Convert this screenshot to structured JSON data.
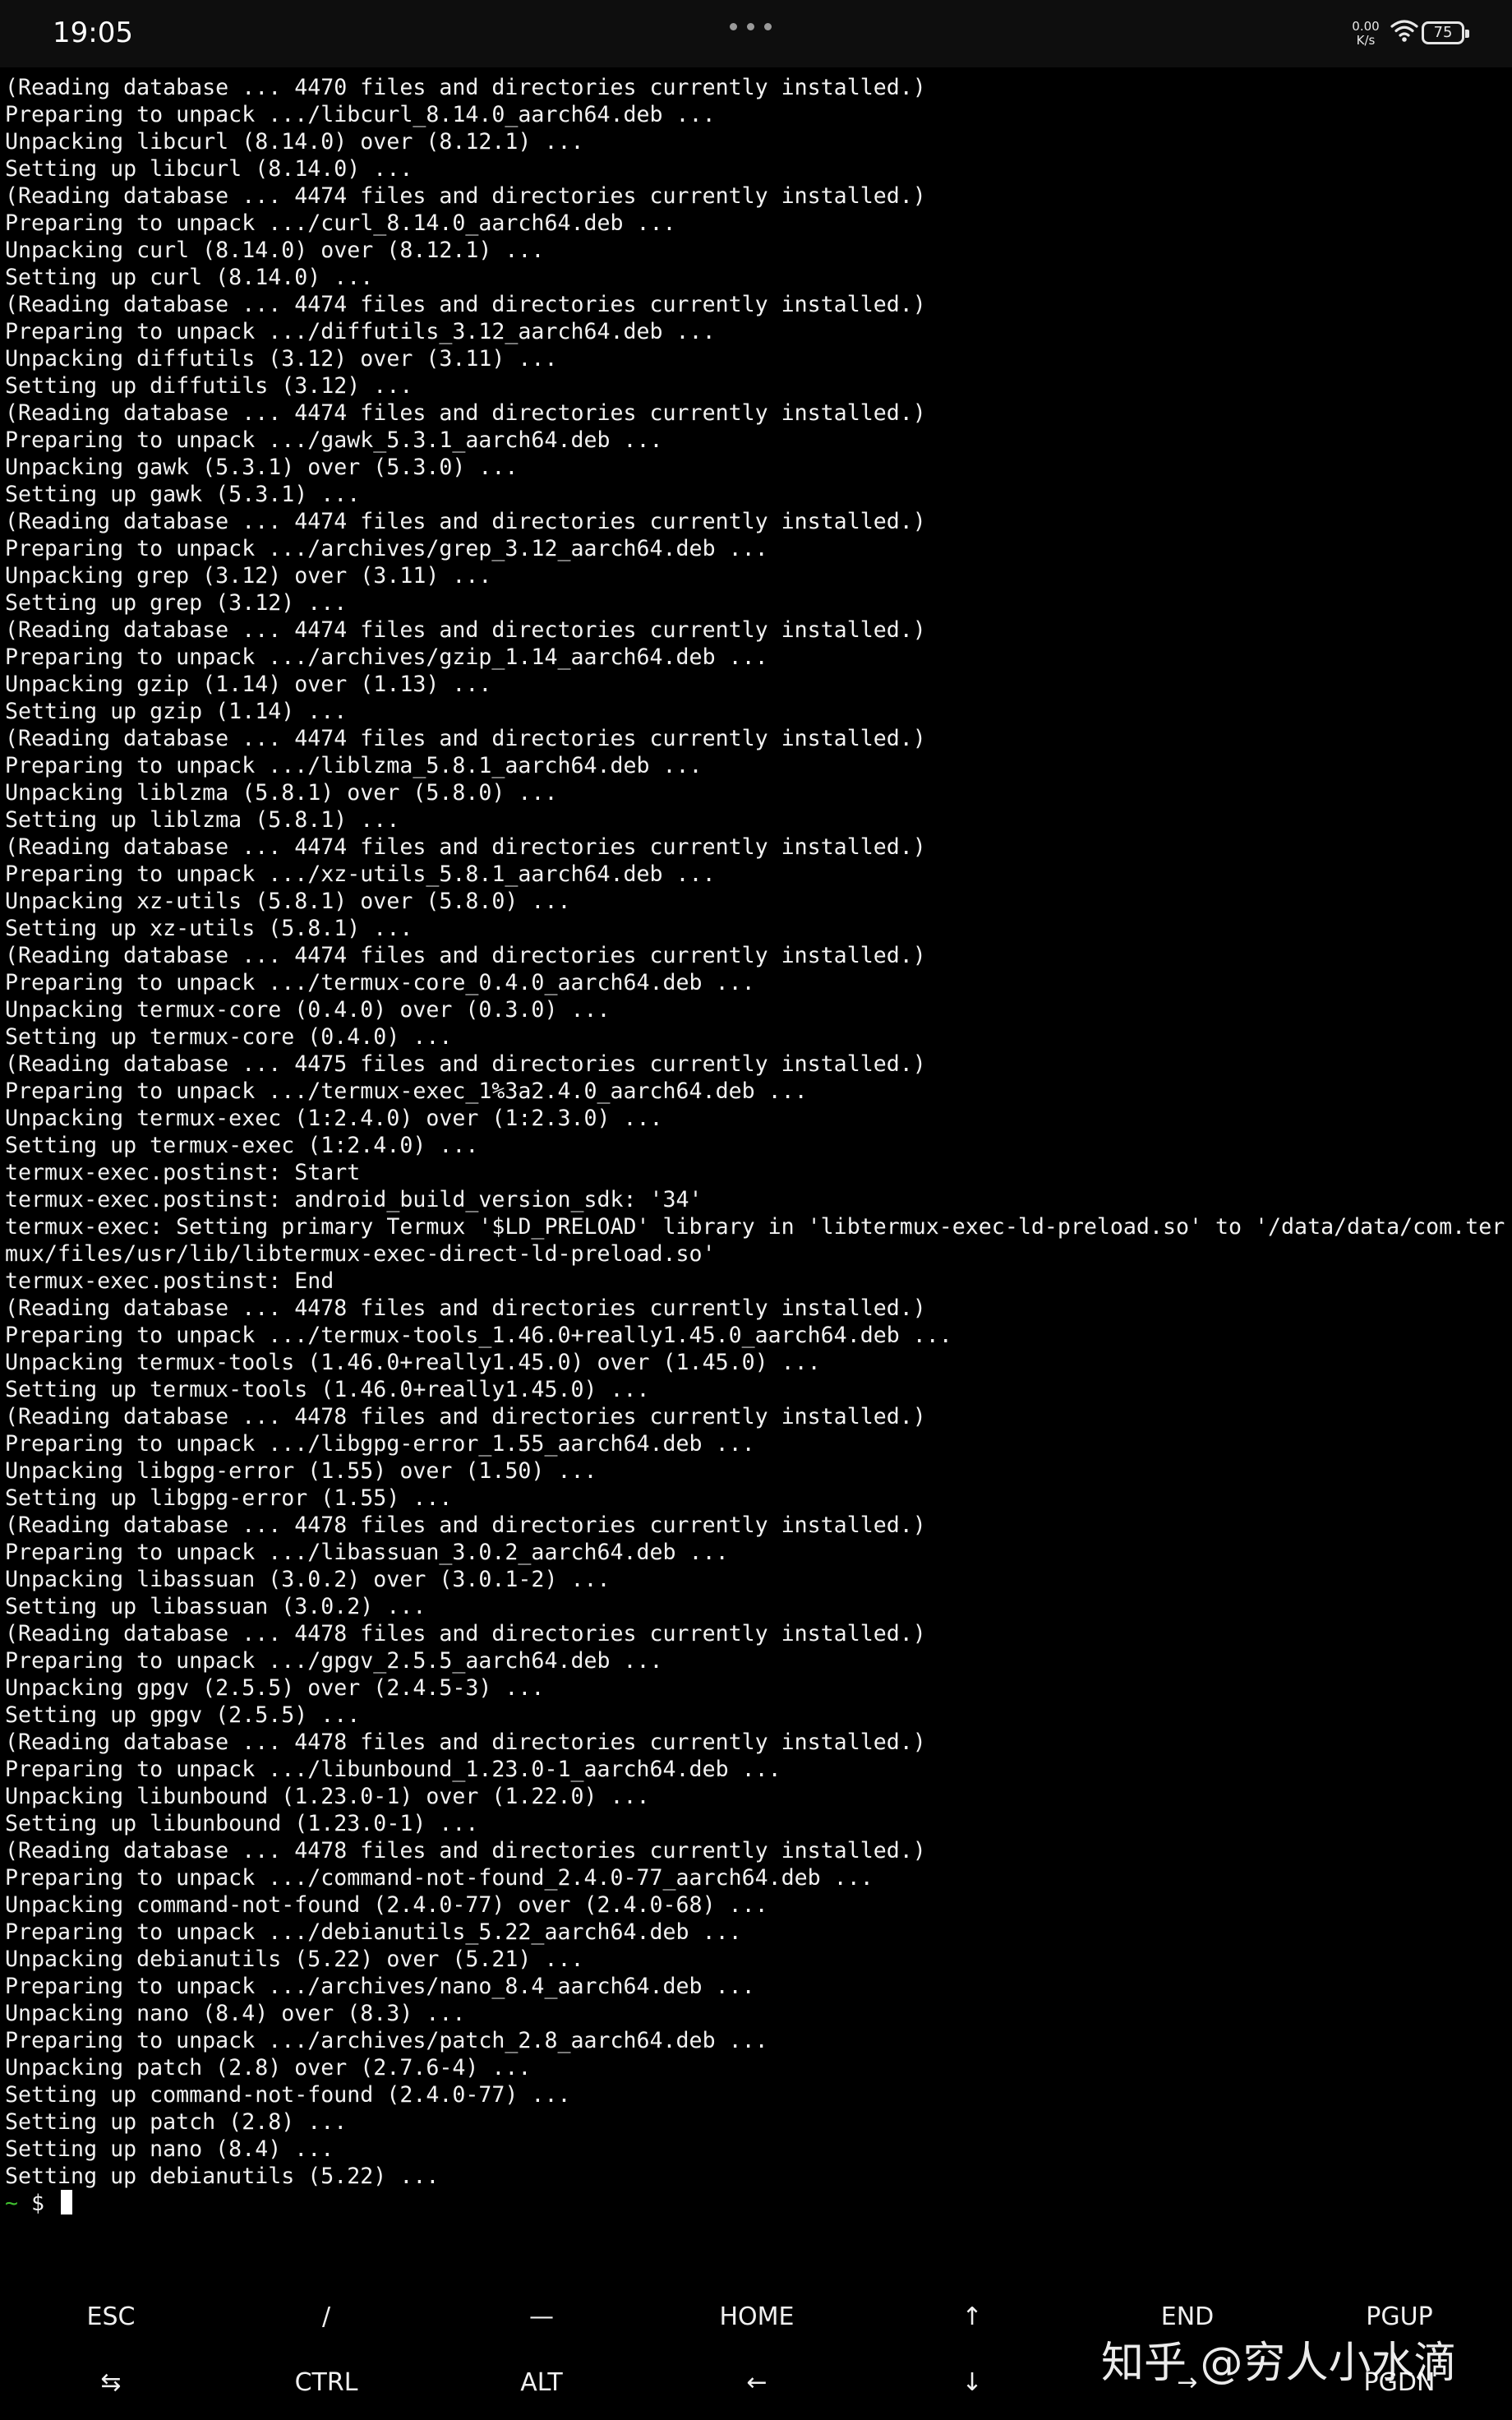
{
  "status_bar": {
    "time": "19:05",
    "net_speed_value": "0.00",
    "net_speed_unit": "K/s",
    "battery": "75"
  },
  "terminal": {
    "lines": [
      "(Reading database ... 4470 files and directories currently installed.)",
      "Preparing to unpack .../libcurl_8.14.0_aarch64.deb ...",
      "Unpacking libcurl (8.14.0) over (8.12.1) ...",
      "Setting up libcurl (8.14.0) ...",
      "(Reading database ... 4474 files and directories currently installed.)",
      "Preparing to unpack .../curl_8.14.0_aarch64.deb ...",
      "Unpacking curl (8.14.0) over (8.12.1) ...",
      "Setting up curl (8.14.0) ...",
      "(Reading database ... 4474 files and directories currently installed.)",
      "Preparing to unpack .../diffutils_3.12_aarch64.deb ...",
      "Unpacking diffutils (3.12) over (3.11) ...",
      "Setting up diffutils (3.12) ...",
      "(Reading database ... 4474 files and directories currently installed.)",
      "Preparing to unpack .../gawk_5.3.1_aarch64.deb ...",
      "Unpacking gawk (5.3.1) over (5.3.0) ...",
      "Setting up gawk (5.3.1) ...",
      "(Reading database ... 4474 files and directories currently installed.)",
      "Preparing to unpack .../archives/grep_3.12_aarch64.deb ...",
      "Unpacking grep (3.12) over (3.11) ...",
      "Setting up grep (3.12) ...",
      "(Reading database ... 4474 files and directories currently installed.)",
      "Preparing to unpack .../archives/gzip_1.14_aarch64.deb ...",
      "Unpacking gzip (1.14) over (1.13) ...",
      "Setting up gzip (1.14) ...",
      "(Reading database ... 4474 files and directories currently installed.)",
      "Preparing to unpack .../liblzma_5.8.1_aarch64.deb ...",
      "Unpacking liblzma (5.8.1) over (5.8.0) ...",
      "Setting up liblzma (5.8.1) ...",
      "(Reading database ... 4474 files and directories currently installed.)",
      "Preparing to unpack .../xz-utils_5.8.1_aarch64.deb ...",
      "Unpacking xz-utils (5.8.1) over (5.8.0) ...",
      "Setting up xz-utils (5.8.1) ...",
      "(Reading database ... 4474 files and directories currently installed.)",
      "Preparing to unpack .../termux-core_0.4.0_aarch64.deb ...",
      "Unpacking termux-core (0.4.0) over (0.3.0) ...",
      "Setting up termux-core (0.4.0) ...",
      "(Reading database ... 4475 files and directories currently installed.)",
      "Preparing to unpack .../termux-exec_1%3a2.4.0_aarch64.deb ...",
      "Unpacking termux-exec (1:2.4.0) over (1:2.3.0) ...",
      "Setting up termux-exec (1:2.4.0) ...",
      "termux-exec.postinst: Start",
      "termux-exec.postinst: android_build_version_sdk: '34'",
      "termux-exec: Setting primary Termux '$LD_PRELOAD' library in 'libtermux-exec-ld-preload.so' to '/data/data/com.ter",
      "mux/files/usr/lib/libtermux-exec-direct-ld-preload.so'",
      "termux-exec.postinst: End",
      "(Reading database ... 4478 files and directories currently installed.)",
      "Preparing to unpack .../termux-tools_1.46.0+really1.45.0_aarch64.deb ...",
      "Unpacking termux-tools (1.46.0+really1.45.0) over (1.45.0) ...",
      "Setting up termux-tools (1.46.0+really1.45.0) ...",
      "(Reading database ... 4478 files and directories currently installed.)",
      "Preparing to unpack .../libgpg-error_1.55_aarch64.deb ...",
      "Unpacking libgpg-error (1.55) over (1.50) ...",
      "Setting up libgpg-error (1.55) ...",
      "(Reading database ... 4478 files and directories currently installed.)",
      "Preparing to unpack .../libassuan_3.0.2_aarch64.deb ...",
      "Unpacking libassuan (3.0.2) over (3.0.1-2) ...",
      "Setting up libassuan (3.0.2) ...",
      "(Reading database ... 4478 files and directories currently installed.)",
      "Preparing to unpack .../gpgv_2.5.5_aarch64.deb ...",
      "Unpacking gpgv (2.5.5) over (2.4.5-3) ...",
      "Setting up gpgv (2.5.5) ...",
      "(Reading database ... 4478 files and directories currently installed.)",
      "Preparing to unpack .../libunbound_1.23.0-1_aarch64.deb ...",
      "Unpacking libunbound (1.23.0-1) over (1.22.0) ...",
      "Setting up libunbound (1.23.0-1) ...",
      "(Reading database ... 4478 files and directories currently installed.)",
      "Preparing to unpack .../command-not-found_2.4.0-77_aarch64.deb ...",
      "Unpacking command-not-found (2.4.0-77) over (2.4.0-68) ...",
      "Preparing to unpack .../debianutils_5.22_aarch64.deb ...",
      "Unpacking debianutils (5.22) over (5.21) ...",
      "Preparing to unpack .../archives/nano_8.4_aarch64.deb ...",
      "Unpacking nano (8.4) over (8.3) ...",
      "Preparing to unpack .../archives/patch_2.8_aarch64.deb ...",
      "Unpacking patch (2.8) over (2.7.6-4) ...",
      "Setting up command-not-found (2.4.0-77) ...",
      "Setting up patch (2.8) ...",
      "Setting up nano (8.4) ...",
      "Setting up debianutils (5.22) ..."
    ],
    "prompt": {
      "tilde": "~",
      "dollar": "$"
    }
  },
  "extra_keys": {
    "row1": [
      "ESC",
      "/",
      "—",
      "HOME",
      "↑",
      "END",
      "PGUP"
    ],
    "row2": [
      "⇆",
      "CTRL",
      "ALT",
      "←",
      "↓",
      "→",
      "PGDN"
    ]
  },
  "watermark": "知乎 @穷人小水滴",
  "colors": {
    "background": "#000000",
    "prompt_green": "#3fbf2f",
    "text": "#f2f2f2"
  }
}
